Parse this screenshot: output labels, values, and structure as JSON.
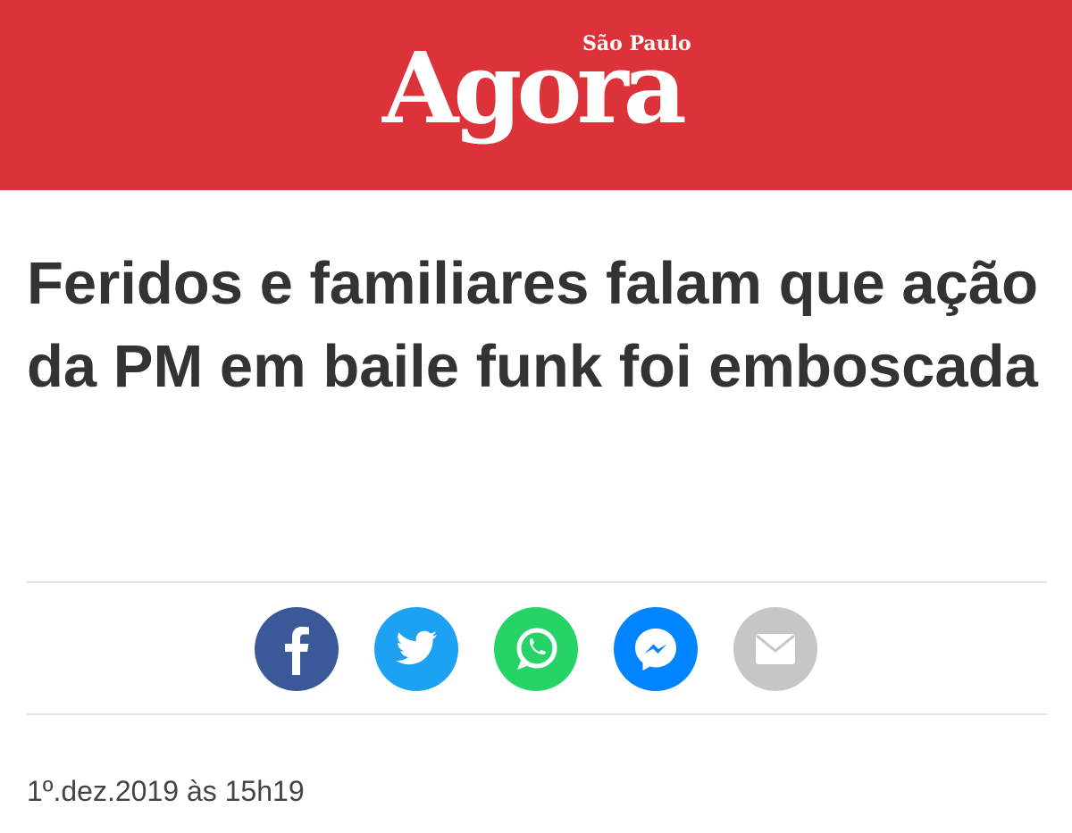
{
  "header": {
    "logo_subtitle": "São Paulo",
    "logo_title": "Agora",
    "background_color": "#dc3239"
  },
  "article": {
    "headline": "Feridos e familiares falam que ação da PM em baile funk foi emboscada",
    "published": "1º.dez.2019 às 15h19"
  },
  "share": {
    "buttons": [
      {
        "name": "facebook",
        "icon": "facebook-icon",
        "color": "#3b5998"
      },
      {
        "name": "twitter",
        "icon": "twitter-icon",
        "color": "#1da1f2"
      },
      {
        "name": "whatsapp",
        "icon": "whatsapp-icon",
        "color": "#25d366"
      },
      {
        "name": "messenger",
        "icon": "messenger-icon",
        "color": "#0084ff"
      },
      {
        "name": "email",
        "icon": "mail-icon",
        "color": "#c6c6c6"
      }
    ]
  }
}
